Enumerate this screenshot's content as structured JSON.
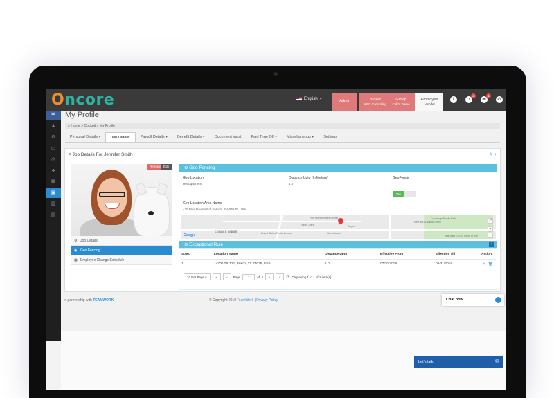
{
  "app": {
    "logo_prefix": "O",
    "logo_rest": "ncore"
  },
  "topbar": {
    "language": "English",
    "roles": [
      {
        "title": "Admin",
        "sub": ""
      },
      {
        "title": "Broker",
        "sub": "KBC Consulting"
      },
      {
        "title": "Group",
        "sub": "Calli's Demo"
      },
      {
        "title": "Employee",
        "sub": "Jennifer"
      }
    ],
    "icons": [
      "info-icon",
      "bell-icon",
      "mail-icon",
      "power-icon"
    ],
    "bell_badge": "0",
    "mail_badge": "0"
  },
  "rail": {
    "items": [
      "menu-icon",
      "users-icon",
      "gear-icon",
      "card-icon",
      "clock-icon",
      "group-icon",
      "building-icon",
      "briefcase-icon",
      "chart-icon",
      "document-icon"
    ]
  },
  "page": {
    "title": "My Profile",
    "breadcrumb": [
      "Home",
      "Cockpit",
      "My Profile"
    ]
  },
  "tabs": [
    "Personal Details",
    "Job Details",
    "Payroll Details",
    "Benefit Details",
    "Document Vault",
    "Paid Time Off",
    "Miscellaneous",
    "Settings"
  ],
  "card": {
    "title": "Job Details For Jennifer Smith",
    "remove_label": "Remove",
    "edit_label": "Edit",
    "side_items": [
      "Job Details",
      "Geo Fencing",
      "Employee Change Schedule"
    ]
  },
  "geo": {
    "heading": "Geo Fencing",
    "location_label": "Geo Location",
    "location_value": "Headquarters",
    "distance_label": "Distance Upto (In Meters)",
    "distance_value": "1.0",
    "geofence_label": "GeoFence",
    "toggle_yes": "Yes",
    "area_label": "Geo Location Area Name",
    "area_value": "430 Blue Ravine Rd, Folsom, CA 95630, USA",
    "map_labels": [
      "PLB Entertainment Center",
      "Trader Joe's",
      "United States Postal Service",
      "HomeGoods",
      "Target",
      "COBBLE RIDGE",
      "The Falls At Willow Creek",
      "Cummings Family Park"
    ],
    "map_brand": "Google",
    "map_footer": "Map data ©2019 Terms of Use"
  },
  "exceptional": {
    "heading": "Exceptional Rule",
    "columns": [
      "S.No.",
      "Location Name",
      "Distance Upto",
      "Effective From",
      "Effective Till",
      "Action"
    ],
    "rows": [
      [
        "1",
        "14700 TX-121, Frisco, TX 75035, USA",
        "1.0",
        "07/30/2019",
        "08/31/2019"
      ]
    ],
    "pager": {
      "per_page": "10 Per Page",
      "page_label": "Page",
      "page_value": "1",
      "of_label": "of",
      "total_pages": "1",
      "summary": "Displaying 1 to 1 of 1 item(s)"
    }
  },
  "footer": {
    "partnership": "In partnership with",
    "partner_brand": "TEAMWORK",
    "copyright": "© Copyright 2019",
    "copyright_link": "TeamWork",
    "separator": "|",
    "privacy": "Privacy Policy"
  },
  "chat": {
    "label": "Chat now",
    "lets_talk": "Let's talk!"
  }
}
